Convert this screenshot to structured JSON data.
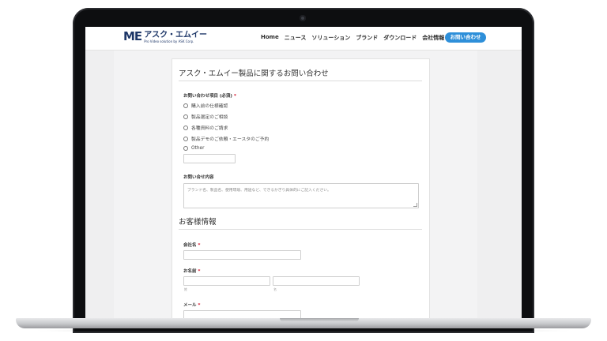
{
  "site": {
    "logo_mark": "ME",
    "logo_name": "アスク・エムイー",
    "logo_tagline": "Pro Video solution by ASK Corp.",
    "brand_color": "#1e3768",
    "accent_color": "#2e8fd9"
  },
  "nav": {
    "items": [
      "Home",
      "ニュース",
      "ソリューション",
      "ブランド",
      "ダウンロード",
      "会社情報"
    ],
    "contact_button": "お問い合わせ"
  },
  "form": {
    "title": "アスク・エムイー製品に関するお問い合わせ",
    "inquiry_type": {
      "label": "お問い合わせ項目 (必須)",
      "required_mark": "*",
      "options": [
        "購入前の仕様確認",
        "製品選定のご相談",
        "各種資料のご請求",
        "製品デモのご依頼・エースタのご予約",
        "Other"
      ]
    },
    "inquiry_content": {
      "label": "お問い合せ内容",
      "placeholder": "ブランド名、製品名、使用環境、用途など、できるかぎり具体的にご記入ください。"
    },
    "customer_section_title": "お客様情報",
    "company": {
      "label": "会社名",
      "required_mark": "*"
    },
    "name": {
      "label": "お名前",
      "required_mark": "*",
      "last_sublabel": "姓",
      "first_sublabel": "名"
    },
    "email": {
      "label": "メール",
      "required_mark": "*"
    }
  }
}
